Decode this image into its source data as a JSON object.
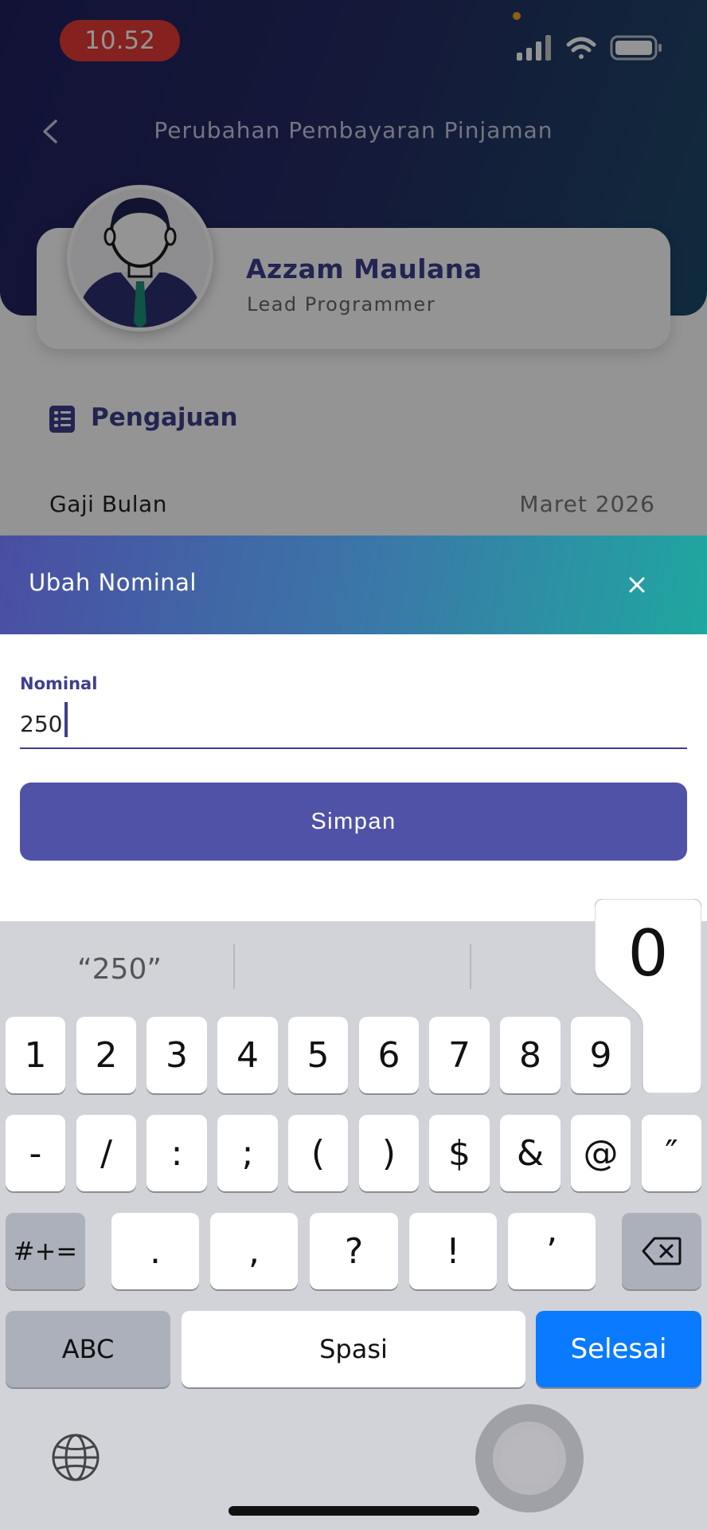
{
  "status_bar": {
    "time": "10.52"
  },
  "header": {
    "title": "Perubahan Pembayaran Pinjaman"
  },
  "profile": {
    "name": "Azzam Maulana",
    "role": "Lead Programmer"
  },
  "section": {
    "title": "Pengajuan"
  },
  "detail_row": {
    "label": "Gaji Bulan",
    "value": "Maret 2026"
  },
  "sheet": {
    "title": "Ubah Nominal",
    "field_label": "Nominal",
    "field_value": "250",
    "save_label": "Simpan"
  },
  "keyboard": {
    "suggestion": "“250”",
    "popup_char": "0",
    "row1": [
      "1",
      "2",
      "3",
      "4",
      "5",
      "6",
      "7",
      "8",
      "9"
    ],
    "row2": [
      "-",
      "/",
      ":",
      ";",
      "(",
      ")",
      "$",
      "&",
      "@",
      "″"
    ],
    "row3": [
      ".",
      ",",
      "?",
      "!",
      "’"
    ],
    "shift_label": "#+=",
    "abc_label": "ABC",
    "space_label": "Spasi",
    "done_label": "Selesai"
  }
}
